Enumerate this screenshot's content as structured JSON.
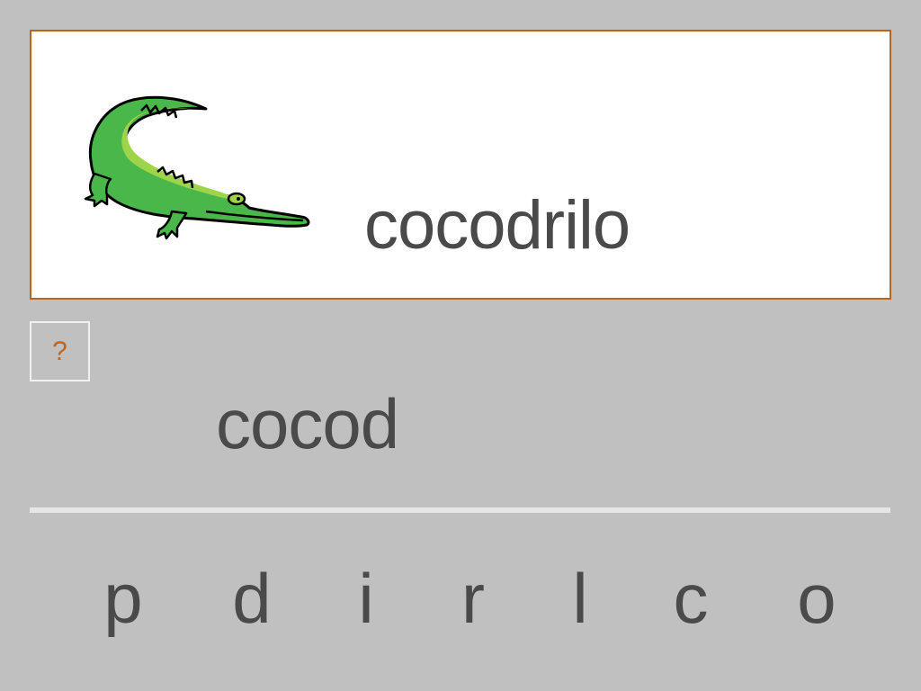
{
  "card": {
    "image_icon": "crocodile-icon",
    "word": "cocodrilo"
  },
  "hint_button": {
    "label": "?"
  },
  "answer": {
    "typed": "cocod"
  },
  "letter_choices": [
    "p",
    "d",
    "i",
    "r",
    "l",
    "c",
    "o"
  ],
  "colors": {
    "background": "#c0c0c0",
    "card_border": "#b8651e",
    "hint_color": "#c0651e",
    "text": "#4a4a4a",
    "croc_green": "#49b749",
    "croc_light_green": "#9ed44a"
  }
}
